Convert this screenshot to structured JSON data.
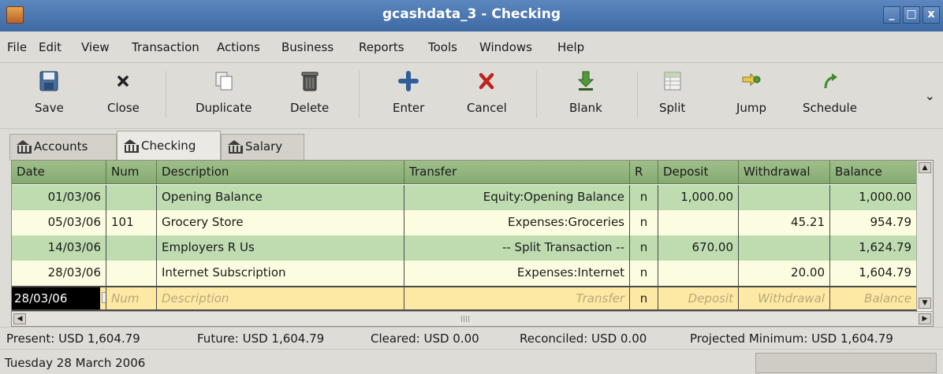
{
  "window": {
    "title": "gcashdata_3 - Checking",
    "buttons": [
      "_",
      "□",
      "x"
    ]
  },
  "menu": [
    "File",
    "Edit",
    "View",
    "Transaction",
    "Actions",
    "Business",
    "Reports",
    "Tools",
    "Windows",
    "Help"
  ],
  "toolbar": {
    "save": "Save",
    "close": "Close",
    "duplicate": "Duplicate",
    "delete": "Delete",
    "enter": "Enter",
    "cancel": "Cancel",
    "blank": "Blank",
    "split": "Split",
    "jump": "Jump",
    "schedule": "Schedule",
    "more": "⌄"
  },
  "tabs": [
    {
      "label": "Accounts",
      "active": false
    },
    {
      "label": "Checking",
      "active": true
    },
    {
      "label": "Salary",
      "active": false
    }
  ],
  "register": {
    "columns": [
      "Date",
      "Num",
      "Description",
      "Transfer",
      "R",
      "Deposit",
      "Withdrawal",
      "Balance"
    ],
    "rows": [
      {
        "date": "01/03/06",
        "num": "",
        "description": "Opening Balance",
        "transfer": "Equity:Opening Balance",
        "r": "n",
        "deposit": "1,000.00",
        "withdrawal": "",
        "balance": "1,000.00"
      },
      {
        "date": "05/03/06",
        "num": "101",
        "description": "Grocery Store",
        "transfer": "Expenses:Groceries",
        "r": "n",
        "deposit": "",
        "withdrawal": "45.21",
        "balance": "954.79"
      },
      {
        "date": "14/03/06",
        "num": "",
        "description": "Employers R Us",
        "transfer": "-- Split Transaction --",
        "r": "n",
        "deposit": "670.00",
        "withdrawal": "",
        "balance": "1,624.79"
      },
      {
        "date": "28/03/06",
        "num": "",
        "description": "Internet Subscription",
        "transfer": "Expenses:Internet",
        "r": "n",
        "deposit": "",
        "withdrawal": "20.00",
        "balance": "1,604.79"
      }
    ],
    "blank": {
      "date": "28/03/06",
      "num": "Num",
      "description": "Description",
      "transfer": "Transfer",
      "r": "n",
      "deposit": "Deposit",
      "withdrawal": "Withdrawal",
      "balance": "Balance"
    }
  },
  "summary": {
    "present": "Present: USD 1,604.79",
    "future": "Future: USD 1,604.79",
    "cleared": "Cleared: USD 0.00",
    "reconciled": "Reconciled: USD 0.00",
    "projected": "Projected Minimum: USD 1,604.79"
  },
  "status": {
    "date": "Tuesday 28 March 2006"
  },
  "colors": {
    "header": "#9fbf8a",
    "row_green": "#bfdcb0",
    "row_yellow": "#fcfde0",
    "edit_row": "#fde9a4",
    "titlebar": "#4a76b1"
  }
}
